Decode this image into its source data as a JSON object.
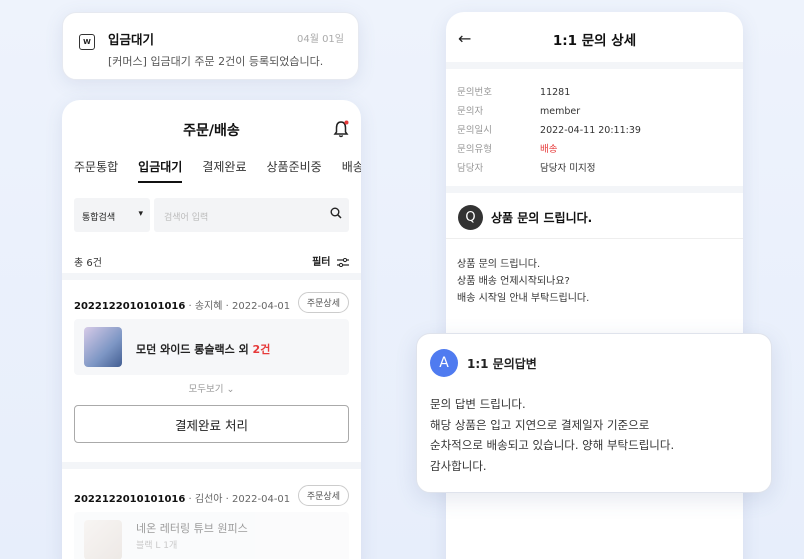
{
  "notification": {
    "icon": "document-w-icon",
    "icon_glyph": "W",
    "title": "입금대기",
    "date": "04월 01일",
    "message": "[커머스] 입금대기 주문 2건이 등록되었습니다."
  },
  "orders_panel": {
    "title": "주문/배송",
    "tabs": [
      "주문통합",
      "입금대기",
      "결제완료",
      "상품준비중",
      "배송중"
    ],
    "active_tab": "입금대기",
    "search": {
      "select_value": "통합검색",
      "placeholder": "검색어 입력"
    },
    "count": "총 6건",
    "filter_label": "필터",
    "orders": [
      {
        "order_no": "2022122010101016",
        "buyer": "송지혜",
        "date": "2022-04-01",
        "detail_label": "주문상세",
        "product": "모던 와이드 롱슬랙스 외",
        "extra_count": "2건",
        "more_label": "모두보기",
        "action_label": "결제완료 처리"
      },
      {
        "order_no": "2022122010101016",
        "buyer": "김선아",
        "date": "2022-04-01",
        "detail_label": "주문상세",
        "product": "네온 레터링 튜브 원피스",
        "option": "블랙 L 1개"
      }
    ]
  },
  "inquiry": {
    "title": "1:1 문의 상세",
    "fields": [
      {
        "key": "문의번호",
        "value": "11281"
      },
      {
        "key": "문의자",
        "value": "member"
      },
      {
        "key": "문의일시",
        "value": "2022-04-11 20:11:39"
      },
      {
        "key": "문의유형",
        "value": "배송"
      },
      {
        "key": "담당자",
        "value": "담당자 미지정"
      }
    ],
    "question_badge": "Q",
    "question_title": "상품 문의 드립니다.",
    "question_lines": [
      "상품 문의 드립니다.",
      "상품 배송 언제시작되나요?",
      "배송 시작일 안내 부탁드립니다."
    ]
  },
  "answer": {
    "badge": "A",
    "title": "1:1 문의답변",
    "lines": [
      "문의 답변 드립니다.",
      "해당 상품은 입고 지연으로 결제일자 기준으로",
      "순차적으로 배송되고 있습니다. 양해 부탁드립니다.",
      "감사합니다."
    ]
  },
  "colors": {
    "accent_red": "#e63a3a",
    "badge_q": "#333333",
    "badge_a": "#4f7bf0",
    "background": "#eef3fc"
  }
}
